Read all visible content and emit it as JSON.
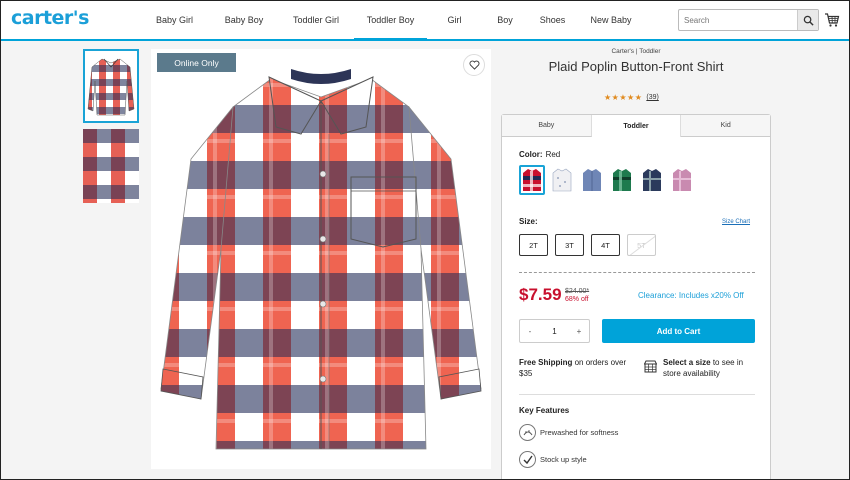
{
  "header": {
    "logo": "carter's",
    "nav": [
      {
        "label": "Baby Girl"
      },
      {
        "label": "Baby Boy"
      },
      {
        "label": "Toddler Girl"
      },
      {
        "label": "Toddler Boy"
      },
      {
        "label": "Girl"
      },
      {
        "label": "Boy"
      },
      {
        "label": "Shoes"
      },
      {
        "label": "New Baby"
      }
    ],
    "active_nav": "Toddler Boy",
    "search": {
      "placeholder": "Search",
      "icon": "search-icon"
    },
    "cart_icon": "cart-icon",
    "accent_color": "#00a3d9"
  },
  "gallery": {
    "badge": "Online Only",
    "favorite_icon": "heart-icon"
  },
  "product": {
    "brand_line": "Carter's | Toddler",
    "title": "Plaid Poplin Button-Front Shirt",
    "stars": "★★★★★",
    "review_count": "(39)",
    "size_tabs": [
      "Baby",
      "Toddler",
      "Kid"
    ],
    "active_size_tab": "Toddler",
    "color_label": "Color:",
    "color_value": "Red",
    "swatches": [
      {
        "name": "red-plaid",
        "colors": [
          "#c8102e",
          "#1f2a55",
          "#ffffff"
        ]
      },
      {
        "name": "white-print",
        "colors": [
          "#f2f2f2",
          "#9aa7c0",
          "#ffffff"
        ]
      },
      {
        "name": "chambray-blue",
        "colors": [
          "#6f86b6",
          "#5a6fa0",
          "#8ea0c8"
        ]
      },
      {
        "name": "green-plaid",
        "colors": [
          "#1e7a4e",
          "#0f3d2a",
          "#7cc2a0"
        ]
      },
      {
        "name": "navy-plaid",
        "colors": [
          "#2b3a5c",
          "#171f33",
          "#5f6f90"
        ]
      },
      {
        "name": "pink-check",
        "colors": [
          "#c98ab0",
          "#a35f8c",
          "#e6bcd6"
        ]
      }
    ],
    "selected_swatch": 0,
    "size_label": "Size:",
    "size_chart": "Size Chart",
    "sizes": [
      {
        "label": "2T",
        "available": true
      },
      {
        "label": "3T",
        "available": true
      },
      {
        "label": "4T",
        "available": true
      },
      {
        "label": "5T",
        "available": false
      }
    ],
    "price": "$7.59",
    "original_price": "$24.00*",
    "percent_off": "68% off",
    "clearance": "Clearance: Includes x20% Off",
    "quantity": {
      "minus": "-",
      "value": "1",
      "plus": "+"
    },
    "add_to_cart": "Add to Cart",
    "shipping_bold": "Free Shipping",
    "shipping_rest": " on orders over $35",
    "store_bold": "Select a size",
    "store_rest": " to see in store availability",
    "key_features_title": "Key Features",
    "features": [
      {
        "icon": "prewashed-icon",
        "label": "Prewashed for softness"
      },
      {
        "icon": "checkmark-icon",
        "label": "Stock up style"
      }
    ],
    "price_color": "#c8102e"
  }
}
